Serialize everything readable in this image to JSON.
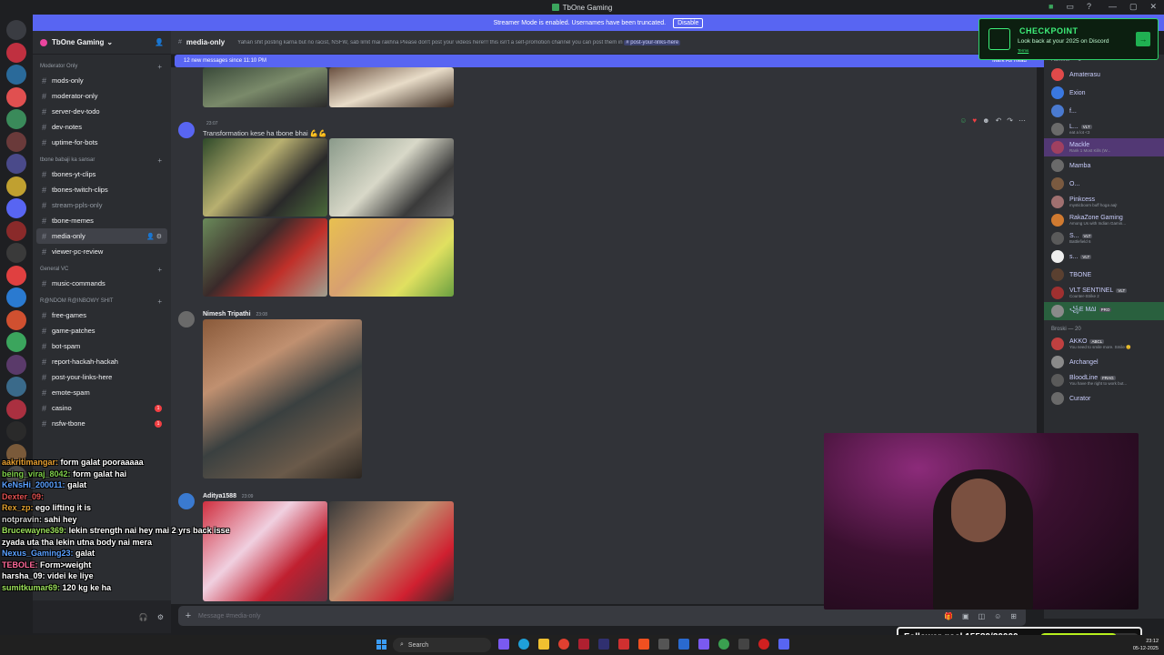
{
  "window": {
    "title": "TbOne Gaming"
  },
  "streamer_bar": {
    "text": "Streamer Mode is enabled. Usernames have been truncated.",
    "disable_label": "Disable"
  },
  "server": {
    "name": "TbOne Gaming"
  },
  "sidebar": {
    "categories": [
      {
        "label": "Moderator Only",
        "channels": [
          {
            "name": "mods-only"
          },
          {
            "name": "moderator-only"
          },
          {
            "name": "server-dev-todo"
          },
          {
            "name": "dev-notes"
          },
          {
            "name": "uptime-for-bots"
          }
        ]
      },
      {
        "label": "tbone babaji ka sansar",
        "channels": [
          {
            "name": "tbones-yt-clips"
          },
          {
            "name": "tbones-twitch-clips"
          },
          {
            "name": "stream-ppls-only"
          },
          {
            "name": "tbone-memes"
          },
          {
            "name": "media-only"
          },
          {
            "name": "viewer-pc-review"
          }
        ]
      },
      {
        "label": "General VC",
        "channels": [
          {
            "name": "music-commands"
          }
        ]
      },
      {
        "label": "R@NDOM R@INBOWY SHIT",
        "channels": [
          {
            "name": "free-games"
          },
          {
            "name": "game-patches"
          },
          {
            "name": "bot-spam"
          },
          {
            "name": "report-hackah-hackah"
          },
          {
            "name": "post-your-links-here"
          },
          {
            "name": "emote-spam"
          },
          {
            "name": "casino",
            "unread": "1"
          },
          {
            "name": "nsfw-tbone",
            "unread": "1"
          }
        ]
      }
    ]
  },
  "channel_header": {
    "name": "media-only",
    "topic": "Yahan shit posting karna but no racist, NSFW, sab limit mai rakhna Please don't post your videos here!!! this isn't a self-promotion channel you can post them in",
    "topic_link": "# post-your-links-here"
  },
  "new_messages": {
    "text": "12 new messages since 11:10 PM",
    "mark_read": "Mark As Read"
  },
  "messages": [
    {
      "author": "",
      "time": "23:07",
      "text": "Transformation kese ha tbone bhai 💪💪"
    },
    {
      "author": "Nimesh Tripathi",
      "time": "23:08",
      "text": ""
    },
    {
      "author": "Aditya1588",
      "time": "23:09",
      "text": ""
    }
  ],
  "composer": {
    "placeholder": "Message #media-only"
  },
  "members": {
    "groups": [
      {
        "label": "Admins — 1",
        "items": [
          {
            "name": "Amaterasu",
            "status": "",
            "color": "#e04a4a"
          },
          {
            "name": "Exion",
            "status": "",
            "color": "#3a78e0"
          },
          {
            "name": "f...",
            "status": "",
            "color": "#4a7ad0"
          },
          {
            "name": "L...",
            "status": "eat a lot <3",
            "color": "#6a6a6a",
            "tag": "VLT"
          },
          {
            "name": "Mackle",
            "status": "Rank 1 Most Kills (W...",
            "color": "#a04060",
            "highlight": "purple"
          },
          {
            "name": "Mamba",
            "status": "",
            "color": "#6a6a6a"
          },
          {
            "name": "O...",
            "status": "",
            "color": "#7a5a40"
          },
          {
            "name": "Pinkcess",
            "status": "mysticboom buff hoga aaj!",
            "color": "#a07070"
          },
          {
            "name": "RakaZone Gaming",
            "status": "Among Us with Indian Gamin...",
            "color": "#d07a30"
          },
          {
            "name": "S...",
            "status": "Battlefield 6",
            "color": "#5a5a5a",
            "tag": "VLT"
          },
          {
            "name": "s...",
            "status": "",
            "color": "#eeeeee",
            "tag": "VLT"
          },
          {
            "name": "TBONE",
            "status": "",
            "color": "#5a4030"
          },
          {
            "name": "VLT SENTINEL",
            "status": "Counter-Strike 2",
            "color": "#a03030",
            "tag": "VLT"
          },
          {
            "name": "꧁E M∆I",
            "status": "",
            "color": "#8a8a8a",
            "tag": "PRO",
            "highlight": "green"
          }
        ]
      },
      {
        "label": "Broski — 20",
        "items": [
          {
            "name": "AKKO",
            "status": "You need to smile more. Smile 😊",
            "color": "#c04040",
            "tag": "ABCL"
          },
          {
            "name": "Archangel",
            "status": "",
            "color": "#8a8a8a"
          },
          {
            "name": "BloodLine",
            "status": "You have the right to work but...",
            "color": "#5a5a5a",
            "tag": "FRAG"
          },
          {
            "name": "Curator",
            "status": "",
            "color": "#6a6a6a"
          }
        ]
      }
    ]
  },
  "checkpoint": {
    "title": "CHECKPOINT",
    "subtitle": "Look back at your 2025 on Discord",
    "small": "Terms"
  },
  "stream_chat": [
    {
      "user": "aakritimangar:",
      "msg": "form galat pooraaaaa",
      "color": "#e8a030"
    },
    {
      "user": "being_viraj_8042:",
      "msg": "form galat hai",
      "color": "#7fd04a"
    },
    {
      "user": "KeNsHi_200011:",
      "msg": "galat",
      "color": "#5aa0ff"
    },
    {
      "user": "Dexter_09:",
      "msg": "",
      "color": "#e05050"
    },
    {
      "user": "Rex_zp:",
      "msg": "ego lifting it is",
      "color": "#e0a030"
    },
    {
      "user": "notpravin:",
      "msg": "sahi hey",
      "color": "#d0d0d0"
    },
    {
      "user": "Brucewayne369:",
      "msg": "lekin strength nai hey mai 2 yrs back isse",
      "color": "#9be05a"
    },
    {
      "user": "",
      "msg": "zyada uta tha lekin utna body nai mera",
      "color": "#ffffff"
    },
    {
      "user": "Nexus_Gaming23:",
      "msg": "galat",
      "color": "#5aa0ff"
    },
    {
      "user": "TEBOLE:",
      "msg": "Form>weight",
      "color": "#ff6a9a"
    },
    {
      "user": "harsha_09:",
      "msg": "videi ke liye",
      "color": "#ffffff"
    },
    {
      "user": "sumitkumar69:",
      "msg": "120 kg ke ha",
      "color": "#9be05a"
    }
  ],
  "follower_goal": {
    "label": "Follower goal 15589/20000",
    "current": 15589,
    "target": 20000
  },
  "taskbar": {
    "search": "Search",
    "time": "23:12",
    "date": "05-12-2025"
  }
}
